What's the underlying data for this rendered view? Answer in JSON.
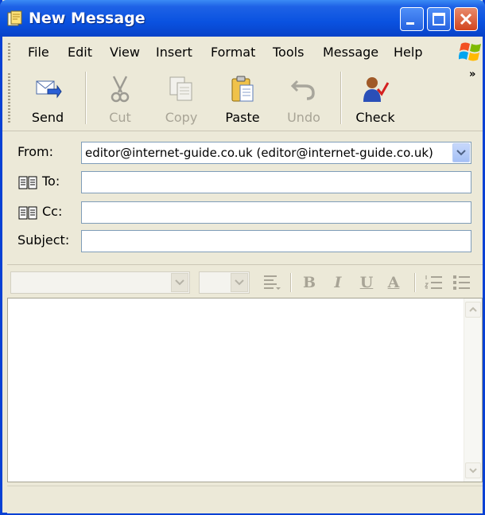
{
  "window": {
    "title": "New Message",
    "accent": "#0a52e0"
  },
  "menu": {
    "items": [
      "File",
      "Edit",
      "View",
      "Insert",
      "Format",
      "Tools",
      "Message",
      "Help"
    ]
  },
  "toolbar": {
    "send": "Send",
    "cut": "Cut",
    "copy": "Copy",
    "paste": "Paste",
    "undo": "Undo",
    "check": "Check"
  },
  "fields": {
    "from_label": "From:",
    "from_value": "editor@internet-guide.co.uk    (editor@internet-guide.co.uk)",
    "to_label": "To:",
    "to_value": "",
    "cc_label": "Cc:",
    "cc_value": "",
    "subject_label": "Subject:",
    "subject_value": ""
  },
  "format": {
    "bold": "B",
    "italic": "I",
    "underline": "U",
    "font_color": "A"
  }
}
